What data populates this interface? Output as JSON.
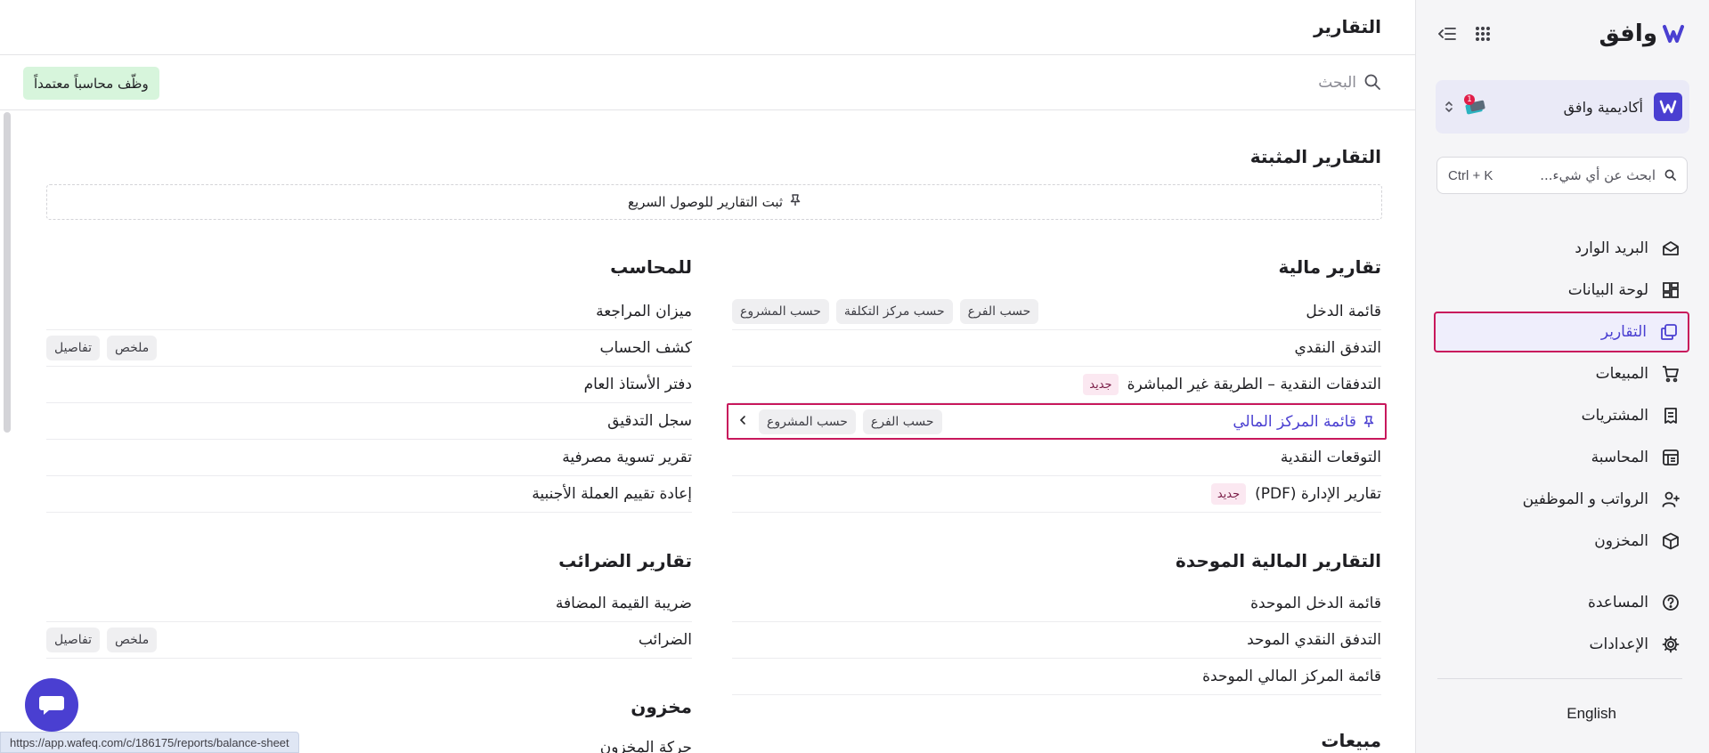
{
  "app": {
    "brand_name": "وافق",
    "page_title": "التقارير",
    "colors": {
      "accent": "#4a3fd1",
      "highlight_border": "#c8185c",
      "hire_badge_bg": "#d7f5dc",
      "new_badge_bg": "#fbe8f1"
    }
  },
  "sidebar": {
    "org_name": "أكاديمية وافق",
    "org_badge_count": "1",
    "search_placeholder": "ابحث عن أي شيء...",
    "search_shortcut": "Ctrl + K",
    "nav": [
      {
        "label": "البريد الوارد",
        "icon": "mail-icon"
      },
      {
        "label": "لوحة البيانات",
        "icon": "dashboard-icon"
      },
      {
        "label": "التقارير",
        "icon": "reports-icon",
        "active": true
      },
      {
        "label": "المبيعات",
        "icon": "cart-icon"
      },
      {
        "label": "المشتريات",
        "icon": "receipt-icon"
      },
      {
        "label": "المحاسبة",
        "icon": "ledger-icon"
      },
      {
        "label": "الرواتب و الموظفين",
        "icon": "users-icon"
      },
      {
        "label": "المخزون",
        "icon": "box-icon"
      }
    ],
    "bottom_nav": [
      {
        "label": "المساعدة",
        "icon": "help-icon"
      },
      {
        "label": "الإعدادات",
        "icon": "gear-icon"
      }
    ],
    "language_link": "English"
  },
  "search": {
    "placeholder": "البحث",
    "hire_badge": "وظّف محاسباً معتمداً"
  },
  "pinned": {
    "title": "التقارير المثبتة",
    "hint": "ثبت التقارير للوصول السريع"
  },
  "financial": {
    "title": "تقارير مالية",
    "rows": [
      {
        "label": "قائمة الدخل",
        "tags": [
          "حسب الفرع",
          "حسب مركز التكلفة",
          "حسب المشروع"
        ]
      },
      {
        "label": "التدفق النقدي",
        "tags": []
      },
      {
        "label": "التدفقات النقدية – الطريقة غير المباشرة",
        "new": "جديد"
      },
      {
        "label": "قائمة المركز المالي",
        "tags": [
          "حسب الفرع",
          "حسب المشروع"
        ],
        "highlighted": true
      },
      {
        "label": "التوقعات النقدية"
      },
      {
        "label": "تقارير الإدارة (PDF)",
        "new": "جديد"
      }
    ]
  },
  "consolidated": {
    "title": "التقارير المالية الموحدة",
    "rows": [
      {
        "label": "قائمة الدخل الموحدة"
      },
      {
        "label": "التدفق النقدي الموحد"
      },
      {
        "label": "قائمة المركز المالي الموحدة"
      }
    ]
  },
  "sales_section": {
    "title": "مبيعات"
  },
  "accountant": {
    "title": "للمحاسب",
    "rows": [
      {
        "label": "ميزان المراجعة"
      },
      {
        "label": "كشف الحساب",
        "tags": [
          "ملخص",
          "تفاصيل"
        ]
      },
      {
        "label": "دفتر الأستاذ العام"
      },
      {
        "label": "سجل التدقيق"
      },
      {
        "label": "تقرير تسوية مصرفية"
      },
      {
        "label": "إعادة تقييم العملة الأجنبية"
      }
    ]
  },
  "tax": {
    "title": "تقارير الضرائب",
    "rows": [
      {
        "label": "ضريبة القيمة المضافة"
      },
      {
        "label": "الضرائب",
        "tags": [
          "ملخص",
          "تفاصيل"
        ]
      }
    ]
  },
  "inventory_section": {
    "title": "مخزون",
    "first_row": "حركة المخزون"
  },
  "status_bar": {
    "url": "https://app.wafeq.com/c/186175/reports/balance-sheet"
  }
}
